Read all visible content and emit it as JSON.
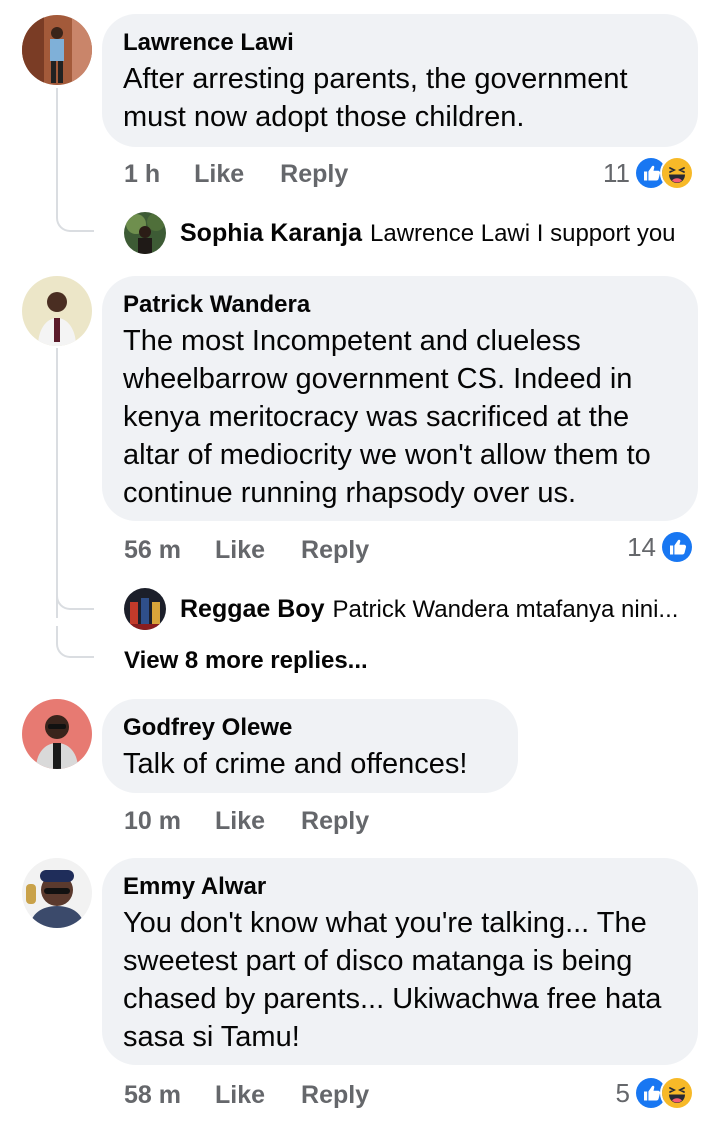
{
  "comments": [
    {
      "author": "Lawrence Lawi",
      "text": "After arresting parents, the government must now adopt those children.",
      "time": "1 h",
      "like": "Like",
      "reply": "Reply",
      "reaction_count": "11",
      "reactions": [
        "like-icon",
        "haha-icon"
      ],
      "replies": [
        {
          "author": "Sophia Karanja",
          "text": "Lawrence Lawi I support you"
        }
      ]
    },
    {
      "author": "Patrick Wandera",
      "text": "The most Incompetent and clueless wheelbarrow government CS. Indeed in kenya meritocracy was sacrificed at the altar of mediocrity we won't allow them to continue running rhapsody over us.",
      "time": "56 m",
      "like": "Like",
      "reply": "Reply",
      "reaction_count": "14",
      "reactions": [
        "like-icon"
      ],
      "replies": [
        {
          "author": "Reggae Boy",
          "text": "Patrick Wandera mtafanya nini..."
        }
      ],
      "view_more": "View 8 more replies..."
    },
    {
      "author": "Godfrey Olewe",
      "text": "Talk of crime and offences!",
      "time": "10 m",
      "like": "Like",
      "reply": "Reply"
    },
    {
      "author": "Emmy Alwar",
      "text": "You don't know what you're talking... The sweetest part of disco matanga is being chased by parents... Ukiwachwa free hata sasa si Tamu!",
      "time": "58 m",
      "like": "Like",
      "reply": "Reply",
      "reaction_count": "5",
      "reactions": [
        "like-icon",
        "haha-icon"
      ]
    }
  ],
  "colors": {
    "bubble": "#f0f2f5",
    "meta_text": "#65676b",
    "like_blue": "#1877f2",
    "haha_yellow": "#f7b928"
  }
}
